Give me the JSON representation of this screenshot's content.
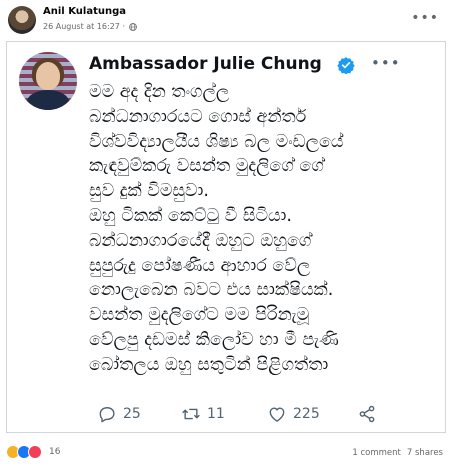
{
  "post": {
    "author": "Anil Kulatunga",
    "timestamp": "26 August at 16:27 ·",
    "privacy_icon": "globe-icon",
    "more_icon": "more-horizontal-icon"
  },
  "tweet": {
    "author_name": "Ambassador Julie Chung",
    "verified_icon": "verified-badge-icon",
    "verified_color": "#1d9bf0",
    "more_icon": "more-horizontal-icon",
    "text": "මම අද දින තංගල්ල\nබන්ධනාගාරයට ගොස් අන්තර්\nවිශ්වවිද්‍යාලයීය ශිෂ්‍ය බල මංඩලයේ\nකැඳවුම්කරු වසන්ත මුදලිගේ ගේ\nසුව දුක් විමසුවා.\nඔහු ටිකක් කෙට්ටු වී සිටියා.\nබන්ධනාගාරයේදී ඔහුට ඔහුගේ\nසුපුරුදු පෝෂණීය ආහාර වේල\nනොලැබෙන බවට එය සාක්ෂියක්.\nවසන්ත මුදලිගේට මම පිරිනැමූ\nවේලපු දඩමස් කිලෝව හා මී පැණි\nබෝතලය ඔහු සතුටින් පිළිගත්තා",
    "actions": {
      "reply_count": "25",
      "retweet_count": "11",
      "like_count": "225"
    }
  },
  "footer": {
    "reaction_count": "16",
    "comments": "1 comment",
    "shares": "7 shares"
  }
}
